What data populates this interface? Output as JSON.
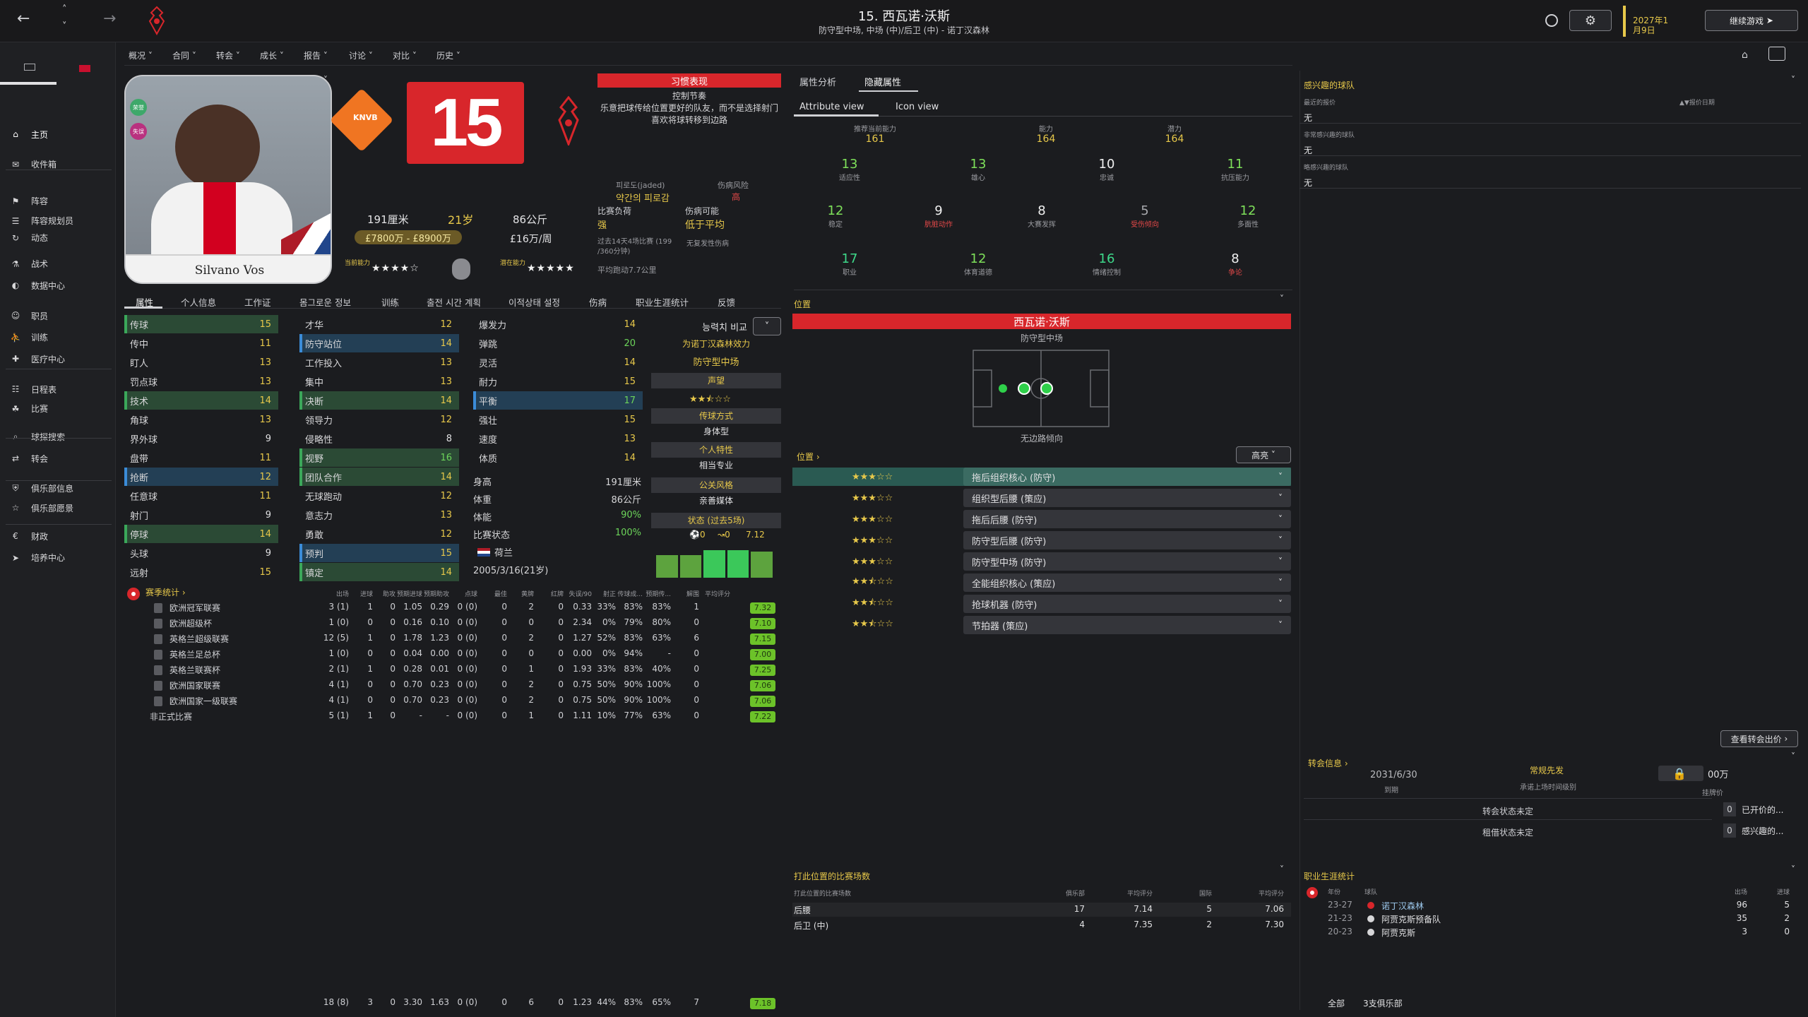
{
  "header": {
    "title": "15. 西瓦诺·沃斯",
    "subtitle": "防守型中场, 中场 (中)/后卫 (中) - 诺丁汉森林",
    "date": "2027年1月9日",
    "continue_label": "继续游戏"
  },
  "sidebar": {
    "items": [
      {
        "label": "主页",
        "icon": "home-icon"
      },
      {
        "label": "收件箱",
        "icon": "inbox-icon"
      },
      {
        "label": "阵容",
        "icon": "squad-icon"
      },
      {
        "label": "阵容规划员",
        "icon": "clipboard-icon"
      },
      {
        "label": "动态",
        "icon": "dynamics-icon"
      },
      {
        "label": "战术",
        "icon": "tactics-icon"
      },
      {
        "label": "数据中心",
        "icon": "data-icon"
      },
      {
        "label": "职员",
        "icon": "staff-icon"
      },
      {
        "label": "训练",
        "icon": "training-icon"
      },
      {
        "label": "医疗中心",
        "icon": "medical-icon"
      },
      {
        "label": "日程表",
        "icon": "calendar-icon"
      },
      {
        "label": "比赛",
        "icon": "trophy-icon"
      },
      {
        "label": "球探搜索",
        "icon": "search-icon"
      },
      {
        "label": "转会",
        "icon": "transfer-icon"
      },
      {
        "label": "俱乐部信息",
        "icon": "shield-icon"
      },
      {
        "label": "俱乐部愿景",
        "icon": "vision-icon"
      },
      {
        "label": "财政",
        "icon": "finance-icon"
      },
      {
        "label": "培养中心",
        "icon": "development-icon"
      }
    ]
  },
  "menu": [
    "概况",
    "合同",
    "转会",
    "成长",
    "报告",
    "讨论",
    "对比",
    "历史"
  ],
  "player": {
    "name_card": "Silvano Vos",
    "number": "15",
    "height": "191厘米",
    "age": "21岁",
    "weight": "86公斤",
    "value": "£7800万 - £8900万",
    "wage": "£16万/周",
    "current_ability_label": "当前能力",
    "potential_ability_label": "潜在能力",
    "current_stars": 4,
    "potential_stars": 5,
    "badge_1": "荣誉",
    "badge_2": "失误"
  },
  "status_panel": {
    "banner": "习惯表现",
    "traits": [
      "控制节奏",
      "乐意把球传给位置更好的队友，而不是选择射门",
      "喜欢将球转移到边路"
    ],
    "fatigue_label": "피로도(jaded)",
    "fatigue_value": "약간의 피로감",
    "injury_risk_label": "伤病风险",
    "injury_risk_value": "高",
    "match_load_label": "比赛负荷",
    "match_load_value": "强",
    "injury_chance_label": "伤病可能",
    "injury_chance_value": "低于平均",
    "load_note": "过去14天4场比赛 (199 /360分钟)",
    "injury_note": "无复发性伤病",
    "avg_run": "平均跑动7.7公里"
  },
  "tabs": [
    "属性",
    "个人信息",
    "工作证",
    "몸그로운 정보",
    "训练",
    "출전 시간 계획",
    "이적상태 설정",
    "伤病",
    "职业生涯统计",
    "反馈"
  ],
  "attributes": {
    "technical": [
      {
        "name": "传球",
        "value": 15,
        "hl": "green"
      },
      {
        "name": "传中",
        "value": 11
      },
      {
        "name": "盯人",
        "value": 13
      },
      {
        "name": "罚点球",
        "value": 13
      },
      {
        "name": "技术",
        "value": 14,
        "hl": "green"
      },
      {
        "name": "角球",
        "value": 13
      },
      {
        "name": "界外球",
        "value": 9
      },
      {
        "name": "盘带",
        "value": 11
      },
      {
        "name": "抢断",
        "value": 12,
        "hl": "blue"
      },
      {
        "name": "任意球",
        "value": 11
      },
      {
        "name": "射门",
        "value": 9
      },
      {
        "name": "停球",
        "value": 14,
        "hl": "green"
      },
      {
        "name": "头球",
        "value": 9
      },
      {
        "name": "远射",
        "value": 15
      }
    ],
    "mental": [
      {
        "name": "才华",
        "value": 12
      },
      {
        "name": "防守站位",
        "value": 14,
        "hl": "blue"
      },
      {
        "name": "工作投入",
        "value": 13
      },
      {
        "name": "集中",
        "value": 13
      },
      {
        "name": "决断",
        "value": 14,
        "hl": "green"
      },
      {
        "name": "领导力",
        "value": 12
      },
      {
        "name": "侵略性",
        "value": 8
      },
      {
        "name": "视野",
        "value": 16,
        "hl": "green"
      },
      {
        "name": "团队合作",
        "value": 14,
        "hl": "green"
      },
      {
        "name": "无球跑动",
        "value": 12
      },
      {
        "name": "意志力",
        "value": 13
      },
      {
        "name": "勇敢",
        "value": 12
      },
      {
        "name": "预判",
        "value": 15,
        "hl": "blue"
      },
      {
        "name": "镇定",
        "value": 14,
        "hl": "green"
      }
    ],
    "physical": [
      {
        "name": "爆发力",
        "value": 14
      },
      {
        "name": "弹跳",
        "value": 20
      },
      {
        "name": "灵活",
        "value": 14
      },
      {
        "name": "耐力",
        "value": 15
      },
      {
        "name": "平衡",
        "value": 17,
        "hl": "blue"
      },
      {
        "name": "强壮",
        "value": 15
      },
      {
        "name": "速度",
        "value": 13
      },
      {
        "name": "体质",
        "value": 14
      }
    ]
  },
  "bio": [
    {
      "label": "身高",
      "value": "191厘米"
    },
    {
      "label": "体重",
      "value": "86公斤"
    },
    {
      "label": "体能",
      "value": "90%"
    },
    {
      "label": "比赛状态",
      "value": "100%"
    },
    {
      "label": "",
      "value": "荷兰"
    },
    {
      "label": "2005/3/16(21岁)",
      "value": ""
    }
  ],
  "side_info": {
    "compare_label": "능력치 비교",
    "effect_title": "为诺丁汉森林效力",
    "effect_value": "防守型中场",
    "reputation_label": "声望",
    "reputation_stars": 2.5,
    "style_label": "传球方式",
    "style_value": "身体型",
    "personality_label": "个人特性",
    "personality_value": "相当专业",
    "media_label": "公关风格",
    "media_value": "亲善媒体",
    "form_label": "状态 (过去5场)",
    "goals": "0",
    "assists": "0",
    "avg": "7.12",
    "form_values": [
      0.7,
      0.7,
      0.85,
      0.85,
      0.8
    ]
  },
  "season_stats": {
    "title": "赛季统计",
    "headers": [
      "出场",
      "进球",
      "助攻",
      "预期进球",
      "预期助攻",
      "点球",
      "最佳",
      "黄牌",
      "红牌",
      "失误/90",
      "射正",
      "传球成...",
      "预期传...",
      "解围",
      "平均评分"
    ],
    "rows": [
      {
        "comp": "欧洲冠军联赛",
        "vals": [
          "3 (1)",
          "1",
          "0",
          "1.05",
          "0.29",
          "0 (0)",
          "0",
          "2",
          "0",
          "0.33",
          "33%",
          "83%",
          "83%",
          "1"
        ],
        "rating": "7.32"
      },
      {
        "comp": "欧洲超级杯",
        "vals": [
          "1 (0)",
          "0",
          "0",
          "0.16",
          "0.10",
          "0 (0)",
          "0",
          "0",
          "0",
          "2.34",
          "0%",
          "79%",
          "80%",
          "0"
        ],
        "rating": "7.10"
      },
      {
        "comp": "英格兰超级联赛",
        "vals": [
          "12 (5)",
          "1",
          "0",
          "1.78",
          "1.23",
          "0 (0)",
          "0",
          "2",
          "0",
          "1.27",
          "52%",
          "83%",
          "63%",
          "6"
        ],
        "rating": "7.15"
      },
      {
        "comp": "英格兰足总杯",
        "vals": [
          "1 (0)",
          "0",
          "0",
          "0.04",
          "0.00",
          "0 (0)",
          "0",
          "0",
          "0",
          "0.00",
          "0%",
          "94%",
          "-",
          "0"
        ],
        "rating": "7.00"
      },
      {
        "comp": "英格兰联赛杯",
        "vals": [
          "2 (1)",
          "1",
          "0",
          "0.28",
          "0.01",
          "0 (0)",
          "0",
          "1",
          "0",
          "1.93",
          "33%",
          "83%",
          "40%",
          "0"
        ],
        "rating": "7.25"
      },
      {
        "comp": "欧洲国家联赛",
        "vals": [
          "4 (1)",
          "0",
          "0",
          "0.70",
          "0.23",
          "0 (0)",
          "0",
          "2",
          "0",
          "0.75",
          "50%",
          "90%",
          "100%",
          "0"
        ],
        "rating": "7.06"
      },
      {
        "comp": "欧洲国家一级联赛",
        "vals": [
          "4 (1)",
          "0",
          "0",
          "0.70",
          "0.23",
          "0 (0)",
          "0",
          "2",
          "0",
          "0.75",
          "50%",
          "90%",
          "100%",
          "0"
        ],
        "rating": "7.06"
      },
      {
        "comp": "非正式比赛",
        "vals": [
          "5 (1)",
          "1",
          "0",
          "-",
          "-",
          "0 (0)",
          "0",
          "1",
          "0",
          "1.11",
          "10%",
          "77%",
          "63%",
          "0"
        ],
        "rating": "7.22"
      }
    ],
    "totals": [
      "18 (8)",
      "3",
      "0",
      "3.30",
      "1.63",
      "0 (0)",
      "0",
      "6",
      "0",
      "1.23",
      "44%",
      "83%",
      "65%",
      "7"
    ],
    "total_rating": "7.18"
  },
  "hidden": {
    "tab1": "属性分析",
    "tab2": "隐藏属性",
    "view1": "Attribute view",
    "view2": "Icon view",
    "top": [
      {
        "label": "推荐当前能力",
        "value": "161"
      },
      {
        "label": "能力",
        "value": "164"
      },
      {
        "label": "潜力",
        "value": "164"
      }
    ],
    "grid": [
      {
        "value": "13",
        "label": "适应性",
        "color": "green"
      },
      {
        "value": "13",
        "label": "雄心",
        "color": "green"
      },
      {
        "value": "10",
        "label": "忠诚",
        "color": "white"
      },
      {
        "value": "11",
        "label": "抗压能力",
        "color": "green"
      },
      {
        "value": "12",
        "label": "稳定",
        "color": "green"
      },
      {
        "value": "9",
        "label": "肮脏动作",
        "color": "white",
        "lblcolor": "red"
      },
      {
        "value": "8",
        "label": "大赛发挥",
        "color": "white"
      },
      {
        "value": "5",
        "label": "受伤倾向",
        "color": "grey",
        "lblcolor": "red"
      },
      {
        "value": "12",
        "label": "多面性",
        "color": "green"
      },
      {
        "value": "17",
        "label": "职业",
        "color": "green2"
      },
      {
        "value": "12",
        "label": "体育道德",
        "color": "green"
      },
      {
        "value": "16",
        "label": "情绪控制",
        "color": "green2"
      },
      {
        "value": "8",
        "label": "争论",
        "color": "white",
        "lblcolor": "red"
      }
    ]
  },
  "position": {
    "title": "位置",
    "player_name": "西瓦诺·沃斯",
    "role": "防守型中场",
    "foot_note": "无边路倾向",
    "roles_title": "位置",
    "highlight_label": "高亮",
    "roles": [
      {
        "stars": 3,
        "name": "拖后组织核心 (防守)",
        "active": true
      },
      {
        "stars": 3,
        "name": "组织型后腰 (策应)"
      },
      {
        "stars": 3,
        "name": "拖后后腰 (防守)"
      },
      {
        "stars": 3,
        "name": "防守型后腰 (防守)"
      },
      {
        "stars": 3,
        "name": "防守型中场 (防守)"
      },
      {
        "stars": 2.5,
        "name": "全能组织核心 (策应)"
      },
      {
        "stars": 2.5,
        "name": "抢球机器 (防守)"
      },
      {
        "stars": 2.5,
        "name": "节拍器 (策应)"
      }
    ]
  },
  "positions_played": {
    "title": "打此位置的比赛场数",
    "headers": [
      "打此位置的比赛场数",
      "俱乐部",
      "平均评分",
      "国际",
      "平均评分"
    ],
    "rows": [
      {
        "pos": "后腰",
        "club": "17",
        "avg": "7.14",
        "intl": "5",
        "intl_avg": "7.06"
      },
      {
        "pos": "后卫 (中)",
        "club": "4",
        "avg": "7.35",
        "intl": "2",
        "intl_avg": "7.30"
      }
    ]
  },
  "interest": {
    "title": "感兴趣的球队",
    "recent_offer": "最近的报价",
    "recent_offer_val": "无",
    "offer_date": "报价日期",
    "very_interested": "非常感兴趣的球队",
    "very_interested_val": "无",
    "slightly_interested": "略感兴趣的球队",
    "slightly_interested_val": "无",
    "view_offer_button": "查看转会出价"
  },
  "transfer": {
    "title": "转会信息",
    "contract_date": "2031/6/30",
    "contract_label": "到期",
    "status": "常规先发",
    "status_note": "承诺上场时间级别",
    "fee": "00万",
    "fee_label": "挂牌价",
    "transfer_status": "转会状态未定",
    "loan_status": "租借状态未定",
    "open_count": "0",
    "open_label": "已开价的...",
    "interest_count": "0",
    "interest_label": "感兴趣的..."
  },
  "career": {
    "title": "职业生涯统计",
    "headers": [
      "年份",
      "球队",
      "出场",
      "进球"
    ],
    "rows": [
      {
        "year": "23-27",
        "team": "诺丁汉森林",
        "apps": "96",
        "goals": "5"
      },
      {
        "year": "21-23",
        "team": "阿贾克斯预备队",
        "apps": "35",
        "goals": "2"
      },
      {
        "year": "20-23",
        "team": "阿贾克斯",
        "apps": "3",
        "goals": "0"
      }
    ],
    "footer_all": "全部",
    "footer_clubs": "3支俱乐部"
  },
  "colors": {
    "accent": "#d8262b",
    "green": "#6cd45a",
    "yellow": "#e7c84a",
    "panel": "#1f2023",
    "rating": "#6cc229"
  }
}
